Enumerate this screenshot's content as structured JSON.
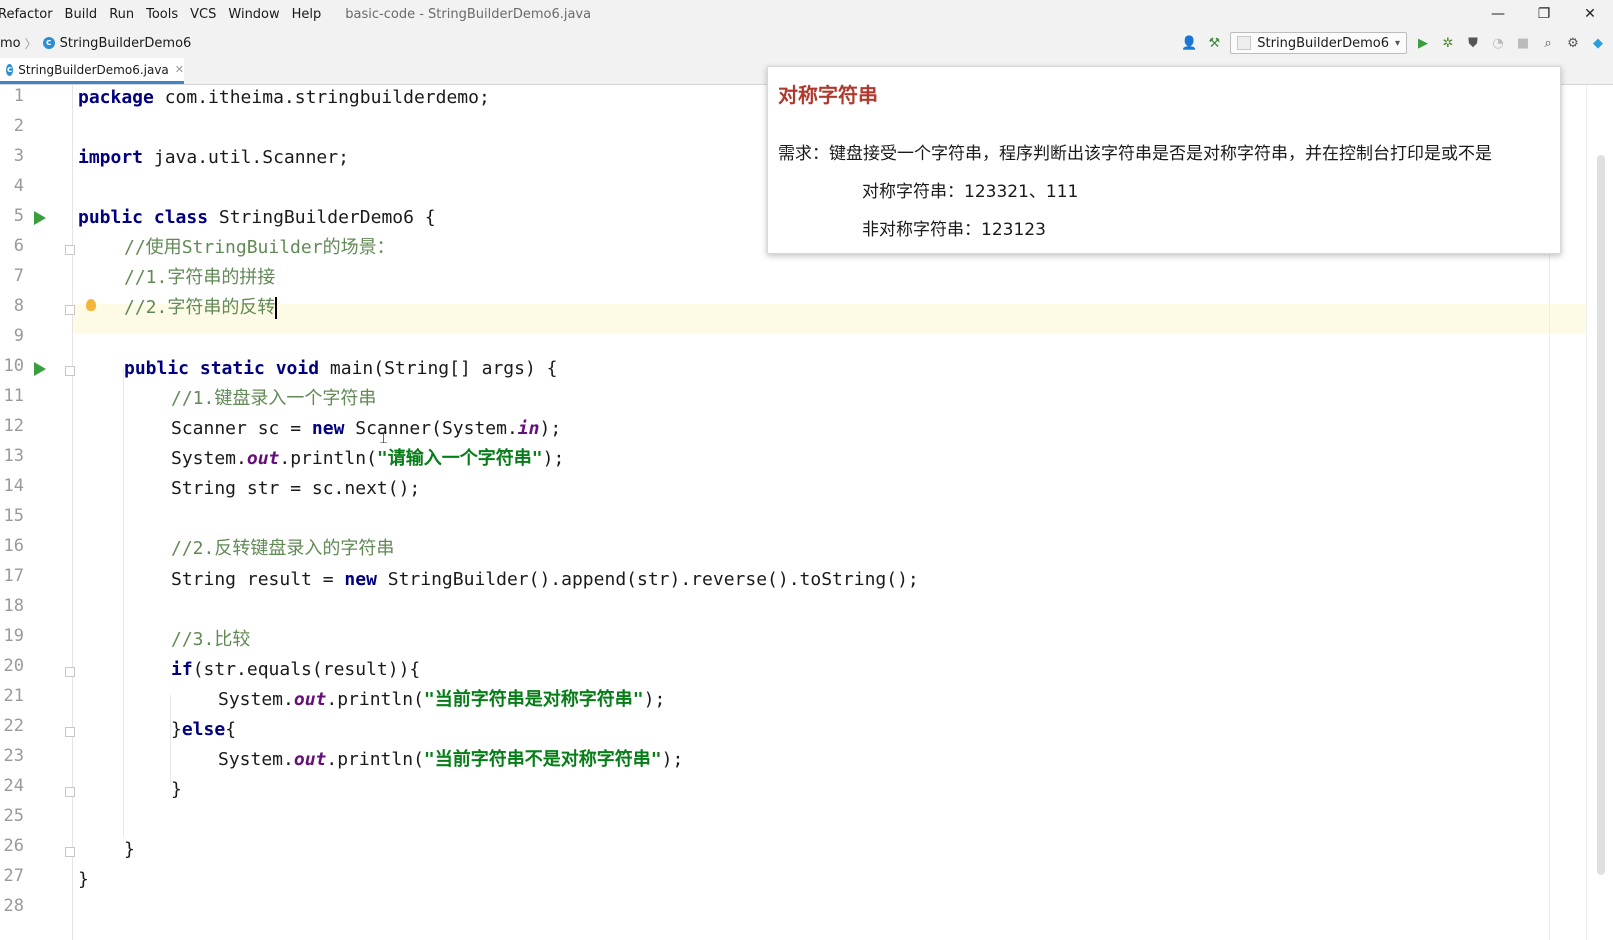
{
  "menubar": {
    "items": [
      "Refactor",
      "Build",
      "Run",
      "Tools",
      "VCS",
      "Window",
      "Help"
    ],
    "window_title": "basic-code - StringBuilderDemo6.java"
  },
  "navbar": {
    "breadcrumb_prefix": "mo",
    "breadcrumb_class": "StringBuilderDemo6",
    "run_config": "StringBuilderDemo6"
  },
  "tabs": [
    {
      "label": "StringBuilderDemo6.java",
      "active": true
    }
  ],
  "editor": {
    "line_numbers": [
      "1",
      "2",
      "3",
      "4",
      "5",
      "6",
      "7",
      "8",
      "9",
      "10",
      "11",
      "12",
      "13",
      "14",
      "15",
      "16",
      "17",
      "18",
      "19",
      "20",
      "21",
      "22",
      "23",
      "24",
      "25",
      "26",
      "27",
      "28"
    ],
    "code": {
      "l1_kw": "package",
      "l1_rest": " com.itheima.stringbuilderdemo;",
      "l3_kw": "import",
      "l3_rest": " java.util.Scanner;",
      "l5_kw": "public class",
      "l5_rest": " StringBuilderDemo6 {",
      "l6_a": "//使用",
      "l6_b": "StringBuilder",
      "l6_c": "的场景：",
      "l7_a": "//1.",
      "l7_b": "字符串的拼接",
      "l8_a": "//2.",
      "l8_b": "字符串的反转",
      "l10_kw": "public static void",
      "l10_rest": " main(String[] args) {",
      "l11_a": "//1.",
      "l11_b": "键盘录入一个字符串",
      "l12_a": "Scanner sc = ",
      "l12_kw": "new",
      "l12_b": " Scanner(System.",
      "l12_f": "in",
      "l12_c": ");",
      "l13_a": "System.",
      "l13_f": "out",
      "l13_b": ".println(",
      "l13_s": "\"请输入一个字符串\"",
      "l13_c": ");",
      "l14": "String str = sc.next();",
      "l16_a": "//2.",
      "l16_b": "反转键盘录入的字符串",
      "l17_a": "String result = ",
      "l17_kw": "new",
      "l17_b": " StringBuilder().append(str).reverse().toString();",
      "l19_a": "//3.",
      "l19_b": "比较",
      "l20_kw": "if",
      "l20_rest": "(str.equals(result)){",
      "l21_a": "System.",
      "l21_f": "out",
      "l21_b": ".println(",
      "l21_s": "\"当前字符串是对称字符串\"",
      "l21_c": ");",
      "l22_a": "}",
      "l22_kw": "else",
      "l22_b": "{",
      "l23_a": "System.",
      "l23_f": "out",
      "l23_b": ".println(",
      "l23_s": "\"当前字符串不是对称字符串\"",
      "l23_c": ");",
      "l24": "}",
      "l26": "}",
      "l27": "}"
    }
  },
  "popup": {
    "title": "对称字符串",
    "requirement": "需求：键盘接受一个字符串，程序判断出该字符串是否是对称字符串，并在控制台打印是或不是",
    "example_yes": "对称字符串：123321、111",
    "example_no": "非对称字符串：123123"
  },
  "colors": {
    "keyword": "#000080",
    "comment": "#808080",
    "string": "#067d17",
    "field": "#660e7a",
    "popup_title": "#b03a2e",
    "run_icon": "#389e3e"
  }
}
